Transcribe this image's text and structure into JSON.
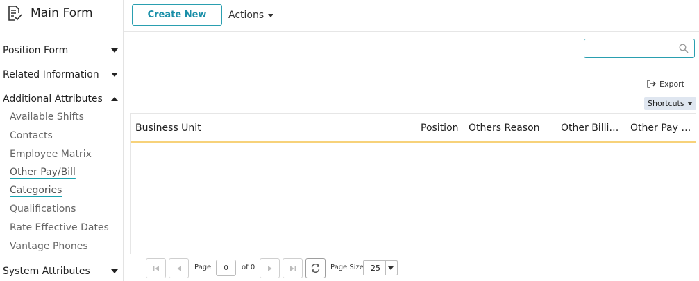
{
  "brand": {
    "title": "Main Form",
    "icon": "form-checklist-icon"
  },
  "sidebar": {
    "sections": [
      {
        "label": "Position Form",
        "state": "collapsed"
      },
      {
        "label": "Related Information",
        "state": "collapsed"
      },
      {
        "label": "Additional Attributes",
        "state": "expanded"
      },
      {
        "label": "System Attributes",
        "state": "collapsed"
      }
    ],
    "sub_items": [
      {
        "label": "Available Shifts"
      },
      {
        "label": "Contacts"
      },
      {
        "label": "Employee Matrix"
      },
      {
        "label": "Other Pay/Bill"
      },
      {
        "label": "Categories"
      },
      {
        "label": "Qualifications"
      },
      {
        "label": "Rate Effective Dates"
      },
      {
        "label": "Vantage Phones"
      }
    ],
    "active_item": "Other Pay/Bill Categories"
  },
  "toolbar": {
    "create_label": "Create New",
    "actions_label": "Actions"
  },
  "search": {
    "placeholder": "",
    "value": "",
    "icon": "search-icon"
  },
  "export": {
    "label": "Export",
    "icon": "export-icon"
  },
  "shortcuts": {
    "label": "Shortcuts"
  },
  "grid": {
    "columns": [
      "Business Unit",
      "Position",
      "Others Reason",
      "Other Billin...",
      "Other Pay R..."
    ],
    "rows": []
  },
  "pager": {
    "page_label": "Page",
    "page_value": "0",
    "of_label": "of 0",
    "page_size_label": "Page Size",
    "page_size_value": "25"
  },
  "colors": {
    "accent": "#2a9fb0",
    "header_underline": "#f7d27a",
    "shortcuts_bg": "#dfe6f0"
  }
}
